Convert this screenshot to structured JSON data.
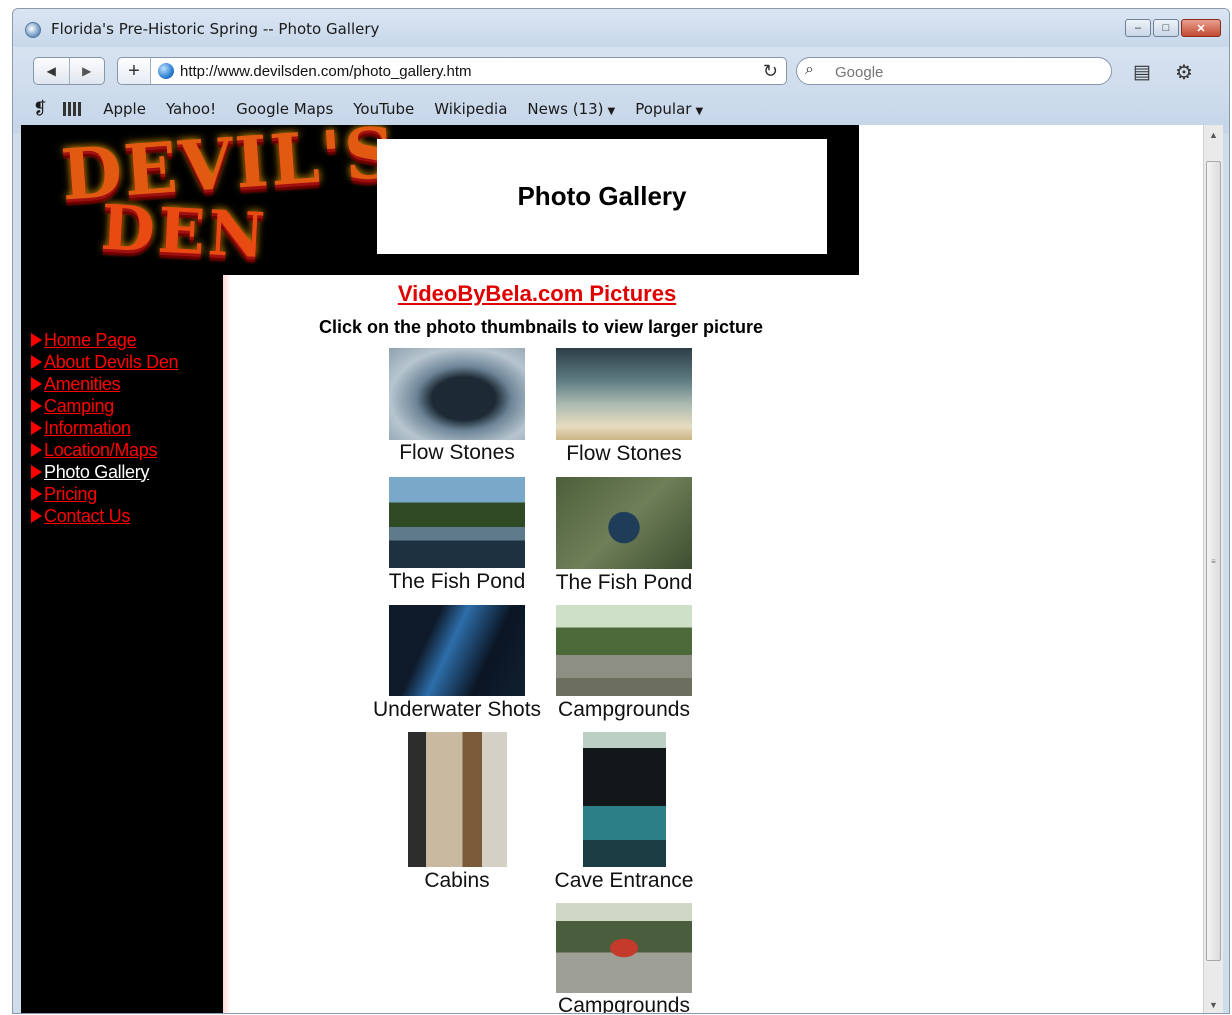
{
  "window": {
    "title": "Florida's Pre-Historic Spring -- Photo Gallery",
    "minimize_glyph": "–",
    "maximize_glyph": "□",
    "close_glyph": "✕"
  },
  "toolbar": {
    "back_glyph": "◀",
    "forward_glyph": "▶",
    "add_glyph": "+",
    "url": "http://www.devilsden.com/photo_gallery.htm",
    "reload_glyph": "↻",
    "search_glyph": "⌕",
    "search_placeholder": "Google",
    "page_menu_glyph": "▤",
    "settings_glyph": "⚙"
  },
  "bookmarks": {
    "book_glyph": "❡",
    "items": [
      "Apple",
      "Yahoo!",
      "Google Maps",
      "YouTube",
      "Wikipedia"
    ],
    "news": "News (13)",
    "popular": "Popular",
    "caret": "▼"
  },
  "page": {
    "logo": {
      "line1": "DEVIL'S",
      "line2": "DEN"
    },
    "title": "Photo Gallery",
    "nav": [
      {
        "label": "Home Page",
        "current": false
      },
      {
        "label": "About Devils Den",
        "current": false
      },
      {
        "label": "Amenities",
        "current": false
      },
      {
        "label": "Camping",
        "current": false
      },
      {
        "label": "Information",
        "current": false
      },
      {
        "label": "Location/Maps",
        "current": false
      },
      {
        "label": "Photo Gallery",
        "current": true
      },
      {
        "label": "Pricing",
        "current": false
      },
      {
        "label": "Contact Us",
        "current": false
      }
    ],
    "section_link": "VideoByBela.com Pictures",
    "instruction": "Click on the photo thumbnails to view larger picture",
    "photos": [
      {
        "caption": "Flow Stones"
      },
      {
        "caption": "Flow Stones"
      },
      {
        "caption": "The Fish Pond"
      },
      {
        "caption": "The Fish Pond"
      },
      {
        "caption": "Underwater Shots"
      },
      {
        "caption": "Campgrounds"
      },
      {
        "caption": "Cabins"
      },
      {
        "caption": "Cave Entrance"
      },
      {
        "caption": "Campgrounds"
      }
    ]
  },
  "scrollbar": {
    "up_glyph": "▲",
    "down_glyph": "▼",
    "grip_glyph": "≡"
  }
}
